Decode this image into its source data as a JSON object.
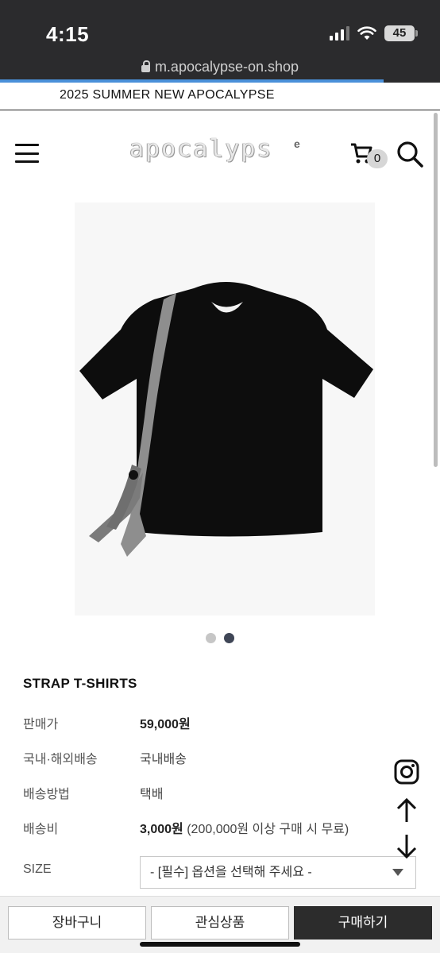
{
  "status_bar": {
    "time": "4:15",
    "battery": "45"
  },
  "address_bar": {
    "url": "m.apocalypse-on.shop"
  },
  "banner": {
    "text": "2025 SUMMER NEW APOCALYPSE"
  },
  "header": {
    "logo_text": "apocalyps",
    "logo_mark": "e",
    "cart_count": "0"
  },
  "gallery": {
    "total_images": 2,
    "active_index": 1
  },
  "product": {
    "name": "STRAP T-SHIRTS",
    "price_label": "판매가",
    "price": "59,000원",
    "shipping_region_label": "국내·해외배송",
    "shipping_region": "국내배송",
    "shipping_method_label": "배송방법",
    "shipping_method": "택배",
    "shipping_fee_label": "배송비",
    "shipping_fee": "3,000원",
    "shipping_fee_note": "(200,000원 이상 구매 시 무료)",
    "size_label": "SIZE",
    "size_select": "- [필수] 옵션을 선택해 주세요 -"
  },
  "bottom_bar": {
    "cart_label": "장바구니",
    "wishlist_label": "관심상품",
    "buy_label": "구매하기"
  },
  "colors": {
    "buy_button": "#2c2c2c",
    "active_dot": "#3f4656",
    "progress": "#4a90d9"
  }
}
